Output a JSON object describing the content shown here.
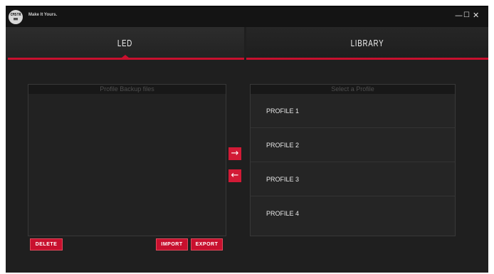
{
  "window": {
    "logo_text": "COOLER MASTER",
    "slogan": "Make It Yours.",
    "controls": {
      "minimize": "—",
      "maximize": "☐",
      "close": "✕"
    }
  },
  "tabs": [
    {
      "label": "LED"
    },
    {
      "label": "LIBRARY"
    }
  ],
  "backup_panel": {
    "header": "Profile Backup files",
    "files": []
  },
  "profile_panel": {
    "header": "Select a Profile",
    "profiles": [
      "PROFILE 1",
      "PROFILE 2",
      "PROFILE 3",
      "PROFILE 4"
    ]
  },
  "transfer": {
    "right_icon": "→",
    "left_icon": "←"
  },
  "buttons": {
    "delete": "DELETE",
    "import": "IMPORT",
    "export": "EXPORT"
  },
  "colors": {
    "accent": "#c8102e",
    "background": "#1f1f1f"
  }
}
